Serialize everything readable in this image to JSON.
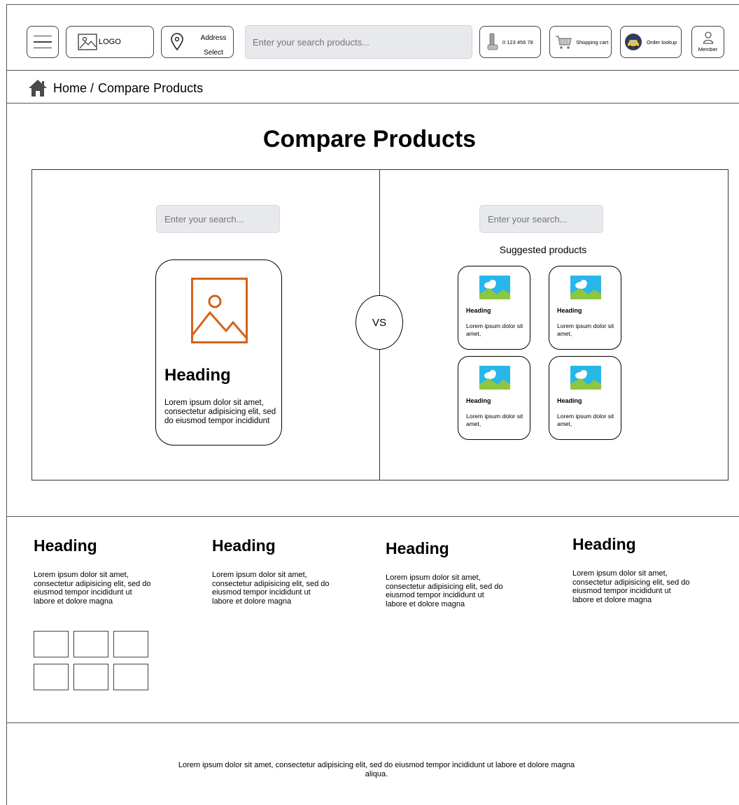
{
  "header": {
    "logo_label": "LOGO",
    "address_line1": "Address",
    "address_line2": "Select",
    "search_placeholder": "Enter your search products...",
    "phone": "0 123 456 78",
    "cart_label": "Shopping cart",
    "order_label": "Order lookup",
    "member_label": "Member"
  },
  "breadcrumb": {
    "home": "Home",
    "separator": "/",
    "current": "Compare Products"
  },
  "page_title": "Compare Products",
  "compare": {
    "left": {
      "search_placeholder": "Enter your search...",
      "card": {
        "heading": "Heading",
        "text": "Lorem ipsum dolor sit amet, consectetur adipisicing elit, sed do eiusmod tempor incididunt"
      }
    },
    "vs_label": "VS",
    "right": {
      "search_placeholder": "Enter your search...",
      "suggested_title": "Suggested products",
      "items": [
        {
          "heading": "Heading",
          "text": "Lorem ipsum dolor sit amet,"
        },
        {
          "heading": "Heading",
          "text": "Lorem ipsum dolor sit amet,"
        },
        {
          "heading": "Heading",
          "text": "Lorem ipsum dolor sit amet,"
        },
        {
          "heading": "Heading",
          "text": "Lorem ipsum dolor sit amet,"
        }
      ]
    }
  },
  "info_columns": [
    {
      "heading": "Heading",
      "text": "Lorem ipsum dolor sit amet, consectetur adipisicing elit, sed do eiusmod tempor incididunt ut labore et dolore magna"
    },
    {
      "heading": "Heading",
      "text": "Lorem ipsum dolor sit amet, consectetur adipisicing elit, sed do eiusmod tempor incididunt ut labore et dolore magna"
    },
    {
      "heading": "Heading",
      "text": "Lorem ipsum dolor sit amet, consectetur adipisicing elit, sed do eiusmod tempor incididunt ut labore et dolore magna"
    },
    {
      "heading": "Heading",
      "text": "Lorem ipsum dolor sit amet, consectetur adipisicing elit, sed do eiusmod tempor incididunt ut labore et dolore magna"
    }
  ],
  "footer_text": "Lorem ipsum dolor sit amet, consectetur adipisicing elit, sed do eiusmod tempor incididunt ut labore et dolore magna aliqua.",
  "colors": {
    "placeholder_accent": "#d4621a",
    "thumbnail_sky": "#29b6e8",
    "thumbnail_hill": "#8dc63f",
    "input_bg": "#e8e9ec"
  },
  "icons": [
    "menu-icon",
    "image-icon",
    "location-pin-icon",
    "phone-icon",
    "shopping-cart-icon",
    "taxi-icon",
    "user-icon",
    "home-icon"
  ]
}
